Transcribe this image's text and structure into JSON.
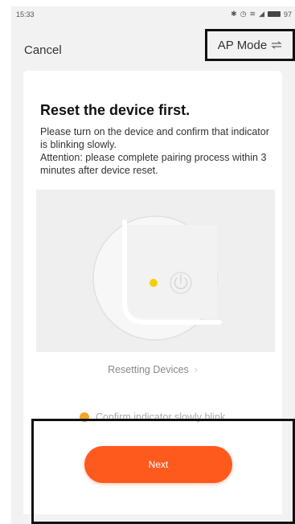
{
  "status_bar": {
    "time": "15:33",
    "battery": "97"
  },
  "nav": {
    "cancel_label": "Cancel",
    "ap_mode_label": "AP Mode"
  },
  "content": {
    "title": "Reset the device first.",
    "instructions": "Please turn on the device and confirm that indicator is blinking slowly.\nAttention: please complete pairing process within 3 minutes after device reset.",
    "reset_link": "Resetting Devices",
    "confirm_text": "Confirm indicator slowly blink"
  },
  "actions": {
    "next_label": "Next"
  },
  "colors": {
    "accent": "#ff5a1e",
    "indicator": "#f5d000",
    "confirm_dot": "#f5a623",
    "background": "#f2f2f2"
  },
  "icons": {
    "ap_mode": "wifi-swap-icon",
    "reset_link": "chevron-right-icon",
    "device_power": "power-icon"
  }
}
